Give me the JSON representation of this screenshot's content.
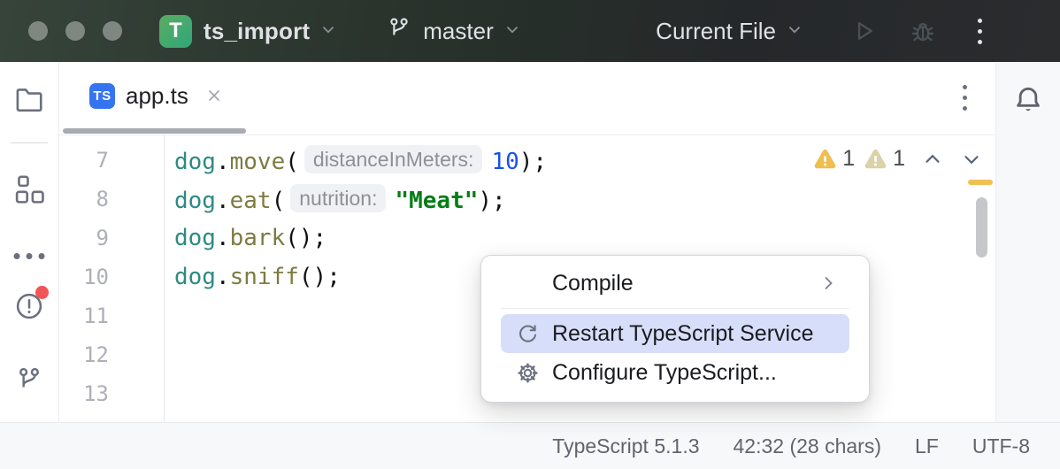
{
  "titlebar": {
    "project_initial": "T",
    "project_name": "ts_import",
    "branch_name": "master",
    "run_config": "Current File"
  },
  "tab": {
    "file_type": "TS",
    "label": "app.ts"
  },
  "editor": {
    "lines": [
      {
        "number": "7",
        "tokens": [
          {
            "t": "var",
            "s": "dog"
          },
          {
            "t": "punct",
            "s": "."
          },
          {
            "t": "method",
            "s": "move"
          },
          {
            "t": "punct",
            "s": "("
          },
          {
            "t": "hint",
            "s": "distanceInMeters:"
          },
          {
            "t": "num",
            "s": "10"
          },
          {
            "t": "punct",
            "s": ");"
          }
        ]
      },
      {
        "number": "8",
        "tokens": [
          {
            "t": "var",
            "s": "dog"
          },
          {
            "t": "punct",
            "s": "."
          },
          {
            "t": "method",
            "s": "eat"
          },
          {
            "t": "punct",
            "s": "("
          },
          {
            "t": "hint",
            "s": "nutrition:"
          },
          {
            "t": "str",
            "s": "\"Meat\""
          },
          {
            "t": "punct",
            "s": ");"
          }
        ]
      },
      {
        "number": "9",
        "tokens": [
          {
            "t": "var",
            "s": "dog"
          },
          {
            "t": "punct",
            "s": "."
          },
          {
            "t": "method",
            "s": "bark"
          },
          {
            "t": "punct",
            "s": "();"
          }
        ]
      },
      {
        "number": "10",
        "tokens": [
          {
            "t": "var",
            "s": "dog"
          },
          {
            "t": "punct",
            "s": "."
          },
          {
            "t": "method",
            "s": "sniff"
          },
          {
            "t": "punct",
            "s": "();"
          }
        ]
      },
      {
        "number": "11",
        "tokens": []
      },
      {
        "number": "12",
        "tokens": []
      },
      {
        "number": "13",
        "tokens": []
      }
    ],
    "warning_count": "1",
    "weak_warning_count": "1"
  },
  "context_menu": {
    "compile": "Compile",
    "restart": "Restart TypeScript Service",
    "configure": "Configure TypeScript..."
  },
  "status_bar": {
    "typescript_version": "TypeScript 5.1.3",
    "caret_info": "42:32 (28 chars)",
    "line_separator": "LF",
    "encoding": "UTF-8"
  },
  "colors": {
    "accent_blue": "#3574F0",
    "menu_highlight": "#D7DEF9",
    "warning_yellow": "#F0BD4E",
    "weak_warning_khaki": "#DCD2A8",
    "error_badge_red": "#F25558",
    "project_badge_green_start": "#5CAB61",
    "project_badge_green_end": "#2FA77B",
    "code_variable": "#2E8A84",
    "code_method": "#7D7B40",
    "code_number": "#1750EB",
    "code_string": "#067D17"
  }
}
